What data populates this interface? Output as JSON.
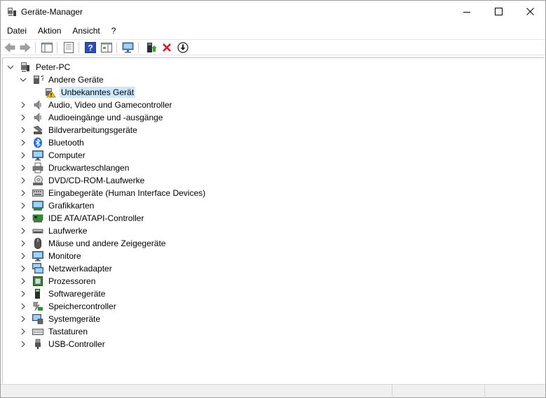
{
  "window": {
    "title": "Geräte-Manager"
  },
  "menu": [
    "Datei",
    "Aktion",
    "Ansicht",
    "?"
  ],
  "toolbar_icons": [
    "back-icon",
    "forward-icon",
    "show-hide-console-tree-icon",
    "properties-icon",
    "help-icon",
    "action-pane-icon",
    "scan-hardware-icon",
    "update-driver-icon",
    "uninstall-icon",
    "disable-device-icon"
  ],
  "tree": {
    "root": "Peter-PC",
    "other_devices": "Andere Geräte",
    "unknown_device": "Unbekanntes Gerät",
    "categories": [
      "Audio, Video und Gamecontroller",
      "Audioeingänge und -ausgänge",
      "Bildverarbeitungsgeräte",
      "Bluetooth",
      "Computer",
      "Druckwarteschlangen",
      "DVD/CD-ROM-Laufwerke",
      "Eingabegeräte (Human Interface Devices)",
      "Grafikkarten",
      "IDE ATA/ATAPI-Controller",
      "Laufwerke",
      "Mäuse und andere Zeigegeräte",
      "Monitore",
      "Netzwerkadapter",
      "Prozessoren",
      "Softwaregeräte",
      "Speichercontroller",
      "Systemgeräte",
      "Tastaturen",
      "USB-Controller"
    ]
  },
  "colors": {
    "selection": "#cce8ff",
    "uninstall_red": "#e81123",
    "help_blue": "#2b4fb5",
    "bluetooth_blue": "#1e6fd9"
  }
}
